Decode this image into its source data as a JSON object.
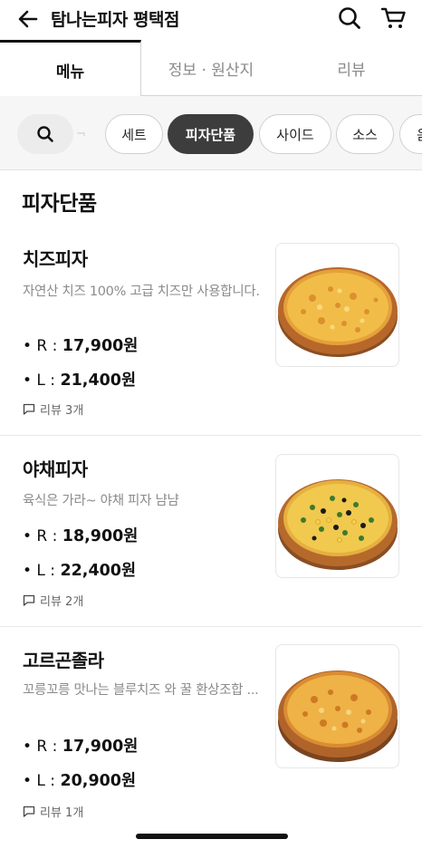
{
  "header": {
    "title": "탐나는피자 평택점"
  },
  "tabs": [
    {
      "label": "메뉴"
    },
    {
      "label": "정보 · 원산지"
    },
    {
      "label": "리뷰"
    }
  ],
  "chips": [
    {
      "label": "세트"
    },
    {
      "label": "피자단품"
    },
    {
      "label": "사이드"
    },
    {
      "label": "소스"
    },
    {
      "label": "음"
    }
  ],
  "section_title": "피자단품",
  "items": [
    {
      "name": "치즈피자",
      "desc": "자연산 치즈 100%  고급 치즈만 사용합니다.",
      "price_r_label": "• R : ",
      "price_r": "17,900원",
      "price_l_label": "• L : ",
      "price_l": "21,400원",
      "review": "리뷰 3개"
    },
    {
      "name": "야채피자",
      "desc": "육식은 가라~ 야채 피자 냠냠",
      "price_r_label": "• R : ",
      "price_r": "18,900원",
      "price_l_label": "• L : ",
      "price_l": "22,400원",
      "review": "리뷰 2개"
    },
    {
      "name": "고르곤졸라",
      "desc": "꼬릉꼬릉 맛나는 블루치즈 와 꿀 환상조합 ...",
      "price_r_label": "• R : ",
      "price_r": "17,900원",
      "price_l_label": "• L : ",
      "price_l": "20,900원",
      "review": "리뷰 1개"
    }
  ],
  "colors": {
    "active_chip": "#3d3d3d",
    "muted_text": "#8b8b8b"
  }
}
